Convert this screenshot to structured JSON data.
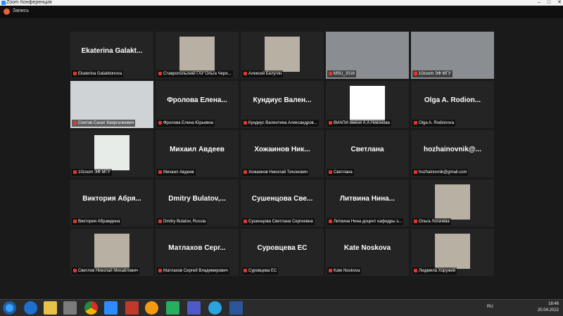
{
  "window": {
    "title": "Zoom Конференция"
  },
  "recording": {
    "label": "Запись"
  },
  "tiles": [
    {
      "name": "Ekaterina Galakt...",
      "caption": "Ekaterina Galaktionova",
      "type": "name"
    },
    {
      "name": "",
      "caption": "Ставропольский ГАУ Ольга Чере...",
      "type": "photo"
    },
    {
      "name": "",
      "caption": "Алексей Белугин",
      "type": "photo"
    },
    {
      "name": "",
      "caption": "MSU_2016",
      "type": "video",
      "active": true
    },
    {
      "name": "",
      "caption": "10zoom ЭФ МГУ",
      "type": "video"
    },
    {
      "name": "",
      "caption": "Сеитов Санат Каиргалиевич",
      "type": "video"
    },
    {
      "name": "Фролова Елена...",
      "caption": "Фролова Елена Юрьевна",
      "type": "name"
    },
    {
      "name": "Кундиус Вален...",
      "caption": "Кундиус Валентина Александров...",
      "type": "name"
    },
    {
      "name": "",
      "caption": "ВИАПИ имени А.А.Никонова",
      "type": "logo"
    },
    {
      "name": "Olga A. Rodion...",
      "caption": "Olga A. Rodionova",
      "type": "name"
    },
    {
      "name": "",
      "caption": "10zoom ЭФ МГУ",
      "type": "logo2"
    },
    {
      "name": "Михаил Авдеев",
      "caption": "Михаил Авдеев",
      "type": "name"
    },
    {
      "name": "Хожаинов Ник...",
      "caption": "Хожаинов Николай Тихонович",
      "type": "name"
    },
    {
      "name": "Светлана",
      "caption": "Светлана",
      "type": "name"
    },
    {
      "name": "hozhainovnik@...",
      "caption": "hozhainovnik@gmail.com",
      "type": "name"
    },
    {
      "name": "Виктория Абря...",
      "caption": "Виктория Абрамдина",
      "type": "name"
    },
    {
      "name": "Dmitry Bulatov,...",
      "caption": "Dmitry Bulatov, Russia",
      "type": "name"
    },
    {
      "name": "Сушенцова Све...",
      "caption": "Сушенцова Светлана Сергеевна",
      "type": "name"
    },
    {
      "name": "Литвина Нина...",
      "caption": "Литвина Нина доцент кафедры э...",
      "type": "name"
    },
    {
      "name": "",
      "caption": "Ольга Логачева",
      "type": "photo"
    },
    {
      "name": "",
      "caption": "Светлов Николай Михайлович",
      "type": "photo"
    },
    {
      "name": "Матлахов Серг...",
      "caption": "Матлахов Сергей Владимирович",
      "type": "name"
    },
    {
      "name": "Суровцева ЕС",
      "caption": "Суровцева ЕС",
      "type": "name"
    },
    {
      "name": "Kate Noskova",
      "caption": "Kate Noskova",
      "type": "name"
    },
    {
      "name": "",
      "caption": "Людмила Хоружий",
      "type": "photo"
    }
  ],
  "taskbar": {
    "apps": [
      "start",
      "ie",
      "explorer",
      "media",
      "chrome",
      "zoom",
      "app-red",
      "app-flower",
      "app-green",
      "teams",
      "telegram",
      "word"
    ],
    "lang": "RU",
    "time": "18:46",
    "date": "20.04.2022"
  }
}
